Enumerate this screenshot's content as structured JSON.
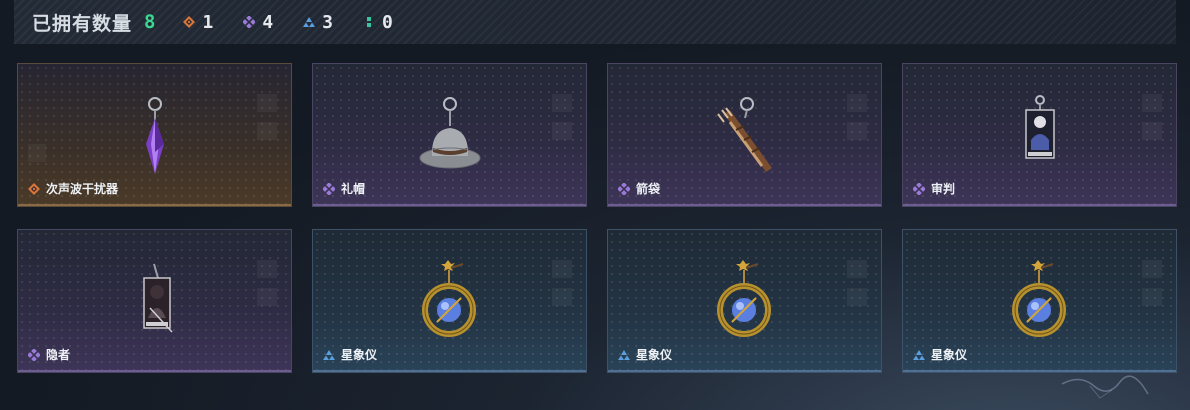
{
  "header": {
    "title": "已拥有数量",
    "total": "8",
    "counts": [
      {
        "tier": "orange",
        "value": "1",
        "icon": "orange-diamond-icon",
        "color": "#d9773a"
      },
      {
        "tier": "purple",
        "value": "4",
        "icon": "purple-diamond-icon",
        "color": "#9a7bd8"
      },
      {
        "tier": "blue",
        "value": "3",
        "icon": "blue-triangle-icon",
        "color": "#5aa0e0"
      },
      {
        "tier": "green",
        "value": "0",
        "icon": "green-dots-icon",
        "color": "#3cc6a0"
      }
    ]
  },
  "items": [
    {
      "name": "次声波干扰器",
      "tier": "orange",
      "art": "purple-crystal-pendant"
    },
    {
      "name": "礼帽",
      "tier": "purple",
      "art": "gray-top-hat"
    },
    {
      "name": "箭袋",
      "tier": "purple",
      "art": "arrow-quiver"
    },
    {
      "name": "审判",
      "tier": "purple",
      "art": "judgment-tarot-card"
    },
    {
      "name": "隐者",
      "tier": "purple",
      "art": "hermit-tarot-card"
    },
    {
      "name": "星象仪",
      "tier": "blue",
      "art": "golden-astrolabe"
    },
    {
      "name": "星象仪",
      "tier": "blue",
      "art": "golden-astrolabe"
    },
    {
      "name": "星象仪",
      "tier": "blue",
      "art": "golden-astrolabe"
    }
  ]
}
